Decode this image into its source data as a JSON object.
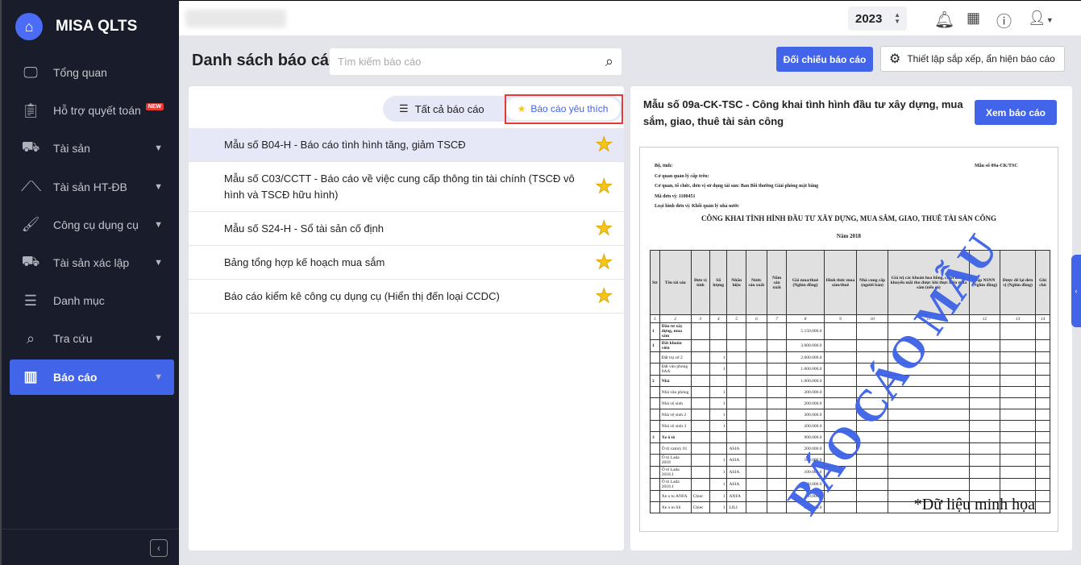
{
  "app": {
    "name": "MISA QLTS"
  },
  "sidebar": {
    "items": [
      {
        "label": "Tổng quan",
        "icon": "monitor-chart-icon",
        "chevron": false
      },
      {
        "label": "Hỗ trợ quyết toán",
        "icon": "clipboard-check-icon",
        "badge": "NEW",
        "chevron": false
      },
      {
        "label": "Tài sản",
        "icon": "house-car-icon",
        "chevron": true
      },
      {
        "label": "Tài sản HT-ĐB",
        "icon": "road-icon",
        "chevron": true
      },
      {
        "label": "Công cụ dụng cụ",
        "icon": "paint-roller-icon",
        "chevron": true
      },
      {
        "label": "Tài sản xác lập",
        "icon": "house-car-icon",
        "chevron": true
      },
      {
        "label": "Danh mục",
        "icon": "list-icon",
        "chevron": false
      },
      {
        "label": "Tra cứu",
        "icon": "search-icon",
        "chevron": true
      },
      {
        "label": "Báo cáo",
        "icon": "bar-chart-icon",
        "chevron": true,
        "active": true
      }
    ]
  },
  "topbar": {
    "year": "2023"
  },
  "page": {
    "title": "Danh sách báo cáo",
    "search_placeholder": "Tìm kiếm báo cáo",
    "compare_button": "Đối chiếu báo cáo",
    "settings_button": "Thiết lập sắp xếp, ẩn hiện báo cáo"
  },
  "tabs": {
    "all": "Tất cả báo cáo",
    "favorite": "Báo cáo yêu thích"
  },
  "reports": [
    "Mẫu số B04-H - Báo cáo tình hình tăng, giảm TSCĐ",
    "Mẫu số C03/CCTT - Báo cáo về việc cung cấp thông tin tài chính (TSCĐ vô hình và TSCĐ hữu hình)",
    "Mẫu số S24-H - Sổ tài sản cố định",
    "Bảng tổng hợp kế hoạch mua sắm",
    "Báo cáo kiểm kê công cụ dụng cụ (Hiển thị đến loại CCDC)"
  ],
  "preview": {
    "title": "Mẫu số 09a-CK-TSC - Công khai tình hình đầu tư xây dựng, mua sắm, giao, thuê tài sản công",
    "view_button": "Xem báo cáo",
    "doc": {
      "form_code": "Mẫu số 09a-CK/TSC",
      "meta": [
        "Bộ, tỉnh:",
        "Cơ quan quản lý cấp trên:",
        "Cơ quan, tổ chức, đơn vị sử dụng tài sản: Ban Bồi thường Giải phóng mặt bằng",
        "Mã đơn vị: 1100451",
        "Loại hình đơn vị: Khối quản lý nhà nước"
      ],
      "heading": "CÔNG KHAI TÌNH HÌNH ĐẦU TƯ XÂY DỰNG, MUA SẮM, GIAO, THUÊ TÀI SẢN CÔNG",
      "year": "Năm 2018",
      "columns": [
        "Stt",
        "Tên tài sản",
        "Đơn vị tính",
        "Số lượng",
        "Nhãn hiệu",
        "Nước sản xuất",
        "Năm sản xuất",
        "Giá mua/thuê (Nghìn đồng)",
        "Hình thức mua sắm/thuê",
        "Nhà cung cấp (người bán)",
        "Giá trị các khoản hoa hồng, chiết khấu, khuyến mãi thu được khi thực hiện mua sắm (nếu có)",
        "Nộp NSNN (Nghìn đồng)",
        "Được để lại đơn vị (Nghìn đồng)",
        "Ghi chú"
      ],
      "col_numbers": [
        "1",
        "2",
        "3",
        "4",
        "5",
        "6",
        "7",
        "8",
        "9",
        "10",
        "11",
        "12",
        "13",
        "14"
      ],
      "rows": [
        [
          "1",
          "Đầu tư xây dựng, mua sắm",
          "",
          "",
          "",
          "",
          "",
          "5.150.000.0"
        ],
        [
          "1",
          "Đất khuôn viên",
          "",
          "",
          "",
          "",
          "",
          "3.000.000.0"
        ],
        [
          "",
          "Đất trụ sở 2",
          "",
          "1",
          "",
          "",
          "",
          "2.000.000.0"
        ],
        [
          "",
          "Đất văn phòng 0AA",
          "",
          "1",
          "",
          "",
          "",
          "1.000.000.0"
        ],
        [
          "2",
          "Nhà",
          "",
          "",
          "",
          "",
          "",
          "1.000.000.0"
        ],
        [
          "",
          "Nhà văn phòng",
          "",
          "1",
          "",
          "",
          "",
          "200.000.0"
        ],
        [
          "",
          "Nhà vệ sinh",
          "",
          "1",
          "",
          "",
          "",
          "200.000.0"
        ],
        [
          "",
          "Nhà vệ sinh 2",
          "",
          "1",
          "",
          "",
          "",
          "300.000.0"
        ],
        [
          "",
          "Nhà vệ sinh 3",
          "",
          "1",
          "",
          "",
          "",
          "200.000.0"
        ],
        [
          "3",
          "Xe ô tô",
          "",
          "",
          "",
          "",
          "",
          "900.000.0"
        ],
        [
          "",
          "Ô tô camry 01",
          "",
          "",
          "ASIA",
          "",
          "",
          "200.000.0"
        ],
        [
          "",
          "Ô tô Lada 2018",
          "",
          "1",
          "ASIA",
          "",
          "",
          "100.000.0"
        ],
        [
          "",
          "Ô tô Lada 2018.1",
          "",
          "1",
          "ASIA",
          "",
          "",
          "100.000.0"
        ],
        [
          "",
          "Ô tô Lada 2018.1",
          "",
          "1",
          "ASIA",
          "",
          "",
          "100.000.0"
        ],
        [
          "",
          "Xe o to ANFA",
          "Chiec",
          "1",
          "ANFA",
          "",
          "",
          "200.000.0"
        ],
        [
          "",
          "Xe o to lili",
          "Chiec",
          "1",
          "LILI",
          "",
          "",
          "200.000.0"
        ]
      ],
      "watermark": "BÁO CÁO MẪU"
    },
    "note": "*Dữ liệu minh họa"
  },
  "colors": {
    "accent": "#4164e8",
    "sidebar": "#181c2b",
    "highlight": "#e53935"
  }
}
